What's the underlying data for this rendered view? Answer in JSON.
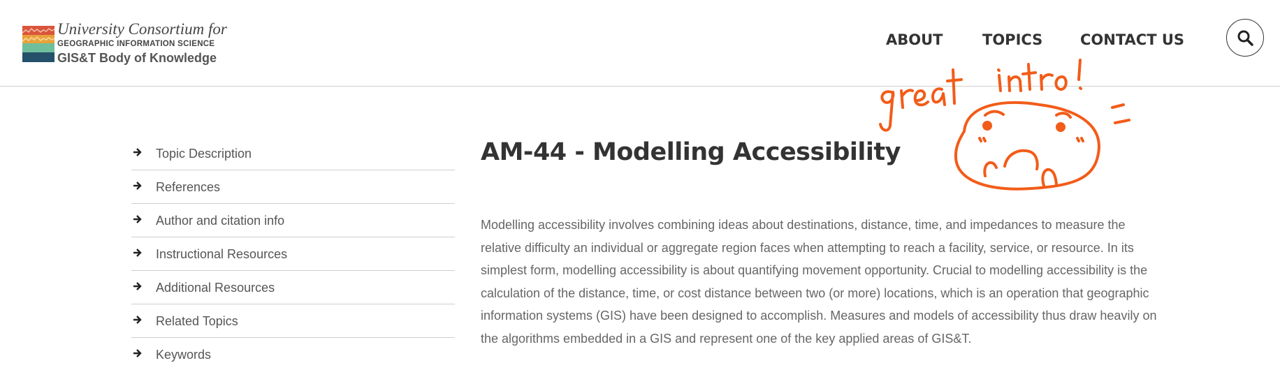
{
  "header": {
    "logo": {
      "line1": "University Consortium for",
      "line2": "GEOGRAPHIC INFORMATION SCIENCE",
      "line3": "GIS&T Body of Knowledge"
    },
    "nav": [
      {
        "label": "ABOUT"
      },
      {
        "label": "TOPICS"
      },
      {
        "label": "CONTACT US"
      }
    ],
    "search_icon": "search-icon"
  },
  "sidebar": {
    "items": [
      {
        "label": "Topic Description",
        "icon": "arrow-right-icon"
      },
      {
        "label": "References",
        "icon": "arrow-right-icon"
      },
      {
        "label": "Author and citation info",
        "icon": "arrow-right-icon"
      },
      {
        "label": "Instructional Resources",
        "icon": "arrow-right-icon"
      },
      {
        "label": "Additional Resources",
        "icon": "arrow-right-icon"
      },
      {
        "label": "Related Topics",
        "icon": "arrow-right-icon"
      },
      {
        "label": "Keywords",
        "icon": "arrow-right-icon"
      }
    ]
  },
  "main": {
    "title": "AM-44 - Modelling Accessibility",
    "description": "Modelling accessibility involves combining ideas about destinations, distance, time, and impedances to measure the relative difficulty an individual or aggregate region faces when attempting to reach a facility, service, or resource. In its simplest form, modelling accessibility is about quantifying movement opportunity. Crucial to modelling accessibility is the calculation of the distance, time, or cost distance between two (or more) locations, which is an operation that geographic information systems (GIS) have been designed to accomplish. Measures and models of accessibility thus draw heavily on the algorithms embedded in a GIS and represent one of the key applied areas of GIS&T."
  },
  "annotation": {
    "text": "great intro!",
    "color": "#f25c19"
  },
  "colors": {
    "text_dark": "#333333",
    "text_body": "#666666",
    "divider": "#cfcfcf",
    "annotation_orange": "#f25c19"
  }
}
